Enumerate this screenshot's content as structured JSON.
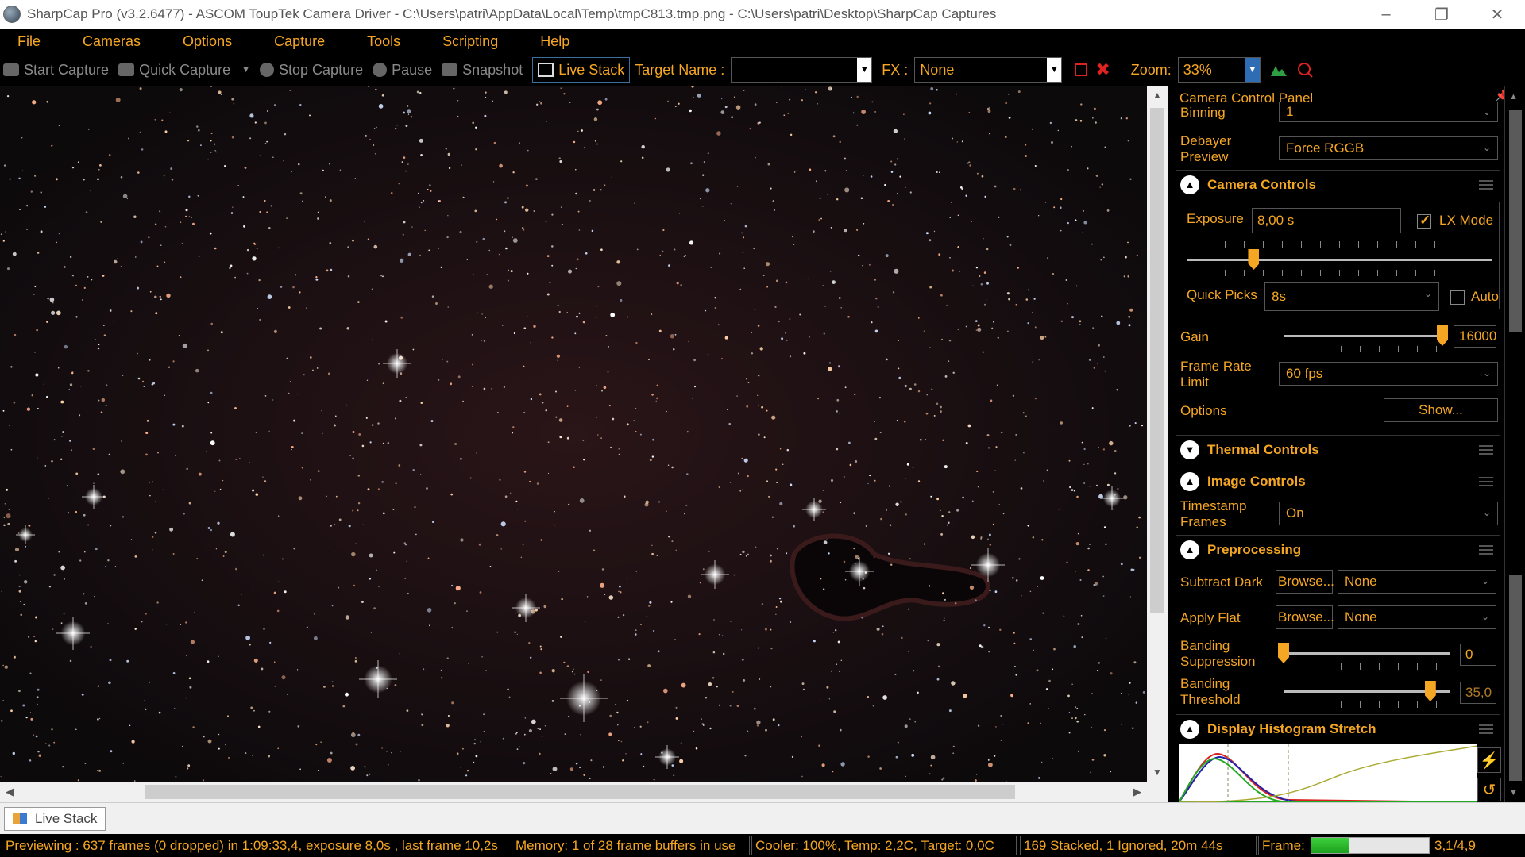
{
  "window": {
    "title": "SharpCap Pro (v3.2.6477) - ASCOM ToupTek Camera Driver - C:\\Users\\patri\\AppData\\Local\\Temp\\tmpC813.tmp.png - C:\\Users\\patri\\Desktop\\SharpCap Captures",
    "minimize_icon": "minimize-icon",
    "maximize_icon": "restore-icon",
    "close_icon": "close-icon"
  },
  "menu": [
    "File",
    "Cameras",
    "Options",
    "Capture",
    "Tools",
    "Scripting",
    "Help"
  ],
  "toolbar": {
    "start_capture": "Start Capture",
    "quick_capture": "Quick Capture",
    "stop_capture": "Stop Capture",
    "pause": "Pause",
    "snapshot": "Snapshot",
    "live_stack": "Live Stack",
    "target_name_label": "Target Name :",
    "target_name_value": "",
    "fx_label": "FX :",
    "fx_value": "None",
    "zoom_label": "Zoom:",
    "zoom_value": "33%"
  },
  "panel": {
    "title": "Camera Control Panel",
    "binning_label": "Binning",
    "binning_value": "1",
    "debayer_label_1": "Debayer",
    "debayer_label_2": "Preview",
    "debayer_value": "Force RGGB",
    "camera_controls": {
      "header": "Camera Controls",
      "exposure_label": "Exposure",
      "exposure_value": "8,00 s",
      "lx_mode_label": "LX Mode",
      "lx_mode_checked": true,
      "exposure_slider_fraction": 0.22,
      "quick_picks_label": "Quick Picks",
      "quick_picks_value": "8s",
      "auto_label": "Auto",
      "auto_checked": false,
      "gain_label": "Gain",
      "gain_value": "16000",
      "gain_slider_fraction": 1.0,
      "frame_rate_label_1": "Frame Rate",
      "frame_rate_label_2": "Limit",
      "frame_rate_value": "60 fps",
      "options_label": "Options",
      "options_button": "Show..."
    },
    "thermal_controls": {
      "header": "Thermal Controls"
    },
    "image_controls": {
      "header": "Image Controls",
      "timestamp_label_1": "Timestamp",
      "timestamp_label_2": "Frames",
      "timestamp_value": "On"
    },
    "preprocessing": {
      "header": "Preprocessing",
      "subtract_dark_label": "Subtract Dark",
      "subtract_dark_browse": "Browse...",
      "subtract_dark_value": "None",
      "apply_flat_label": "Apply Flat",
      "apply_flat_browse": "Browse...",
      "apply_flat_value": "None",
      "banding_supp_label_1": "Banding",
      "banding_supp_label_2": "Suppression",
      "banding_supp_value": "0",
      "banding_supp_fraction": 0.0,
      "banding_thresh_label_1": "Banding",
      "banding_thresh_label_2": "Threshold",
      "banding_thresh_value": "35,0",
      "banding_thresh_fraction": 0.88
    },
    "histogram": {
      "header": "Display Histogram Stretch",
      "auto_stretch_icon": "lightning-icon",
      "reset_icon": "reset-icon"
    }
  },
  "tabs": [
    "Live Stack"
  ],
  "status": {
    "preview": "Previewing : 637 frames (0 dropped) in 1:09:33,4, exposure 8,0s , last frame 10,2s",
    "memory": "Memory: 1 of 28 frame buffers in use",
    "cooler": "Cooler: 100%, Temp: 2,2C, Target: 0,0C",
    "stacked": "169 Stacked, 1 Ignored, 20m 44s",
    "frame_label": "Frame:",
    "frame_progress_fraction": 0.32,
    "fps": "3,1/4,9"
  },
  "colors": {
    "accent": "#f5a623",
    "background": "#000000",
    "highlight_border": "#3a6fa0",
    "progress": "#2fbf2f"
  }
}
